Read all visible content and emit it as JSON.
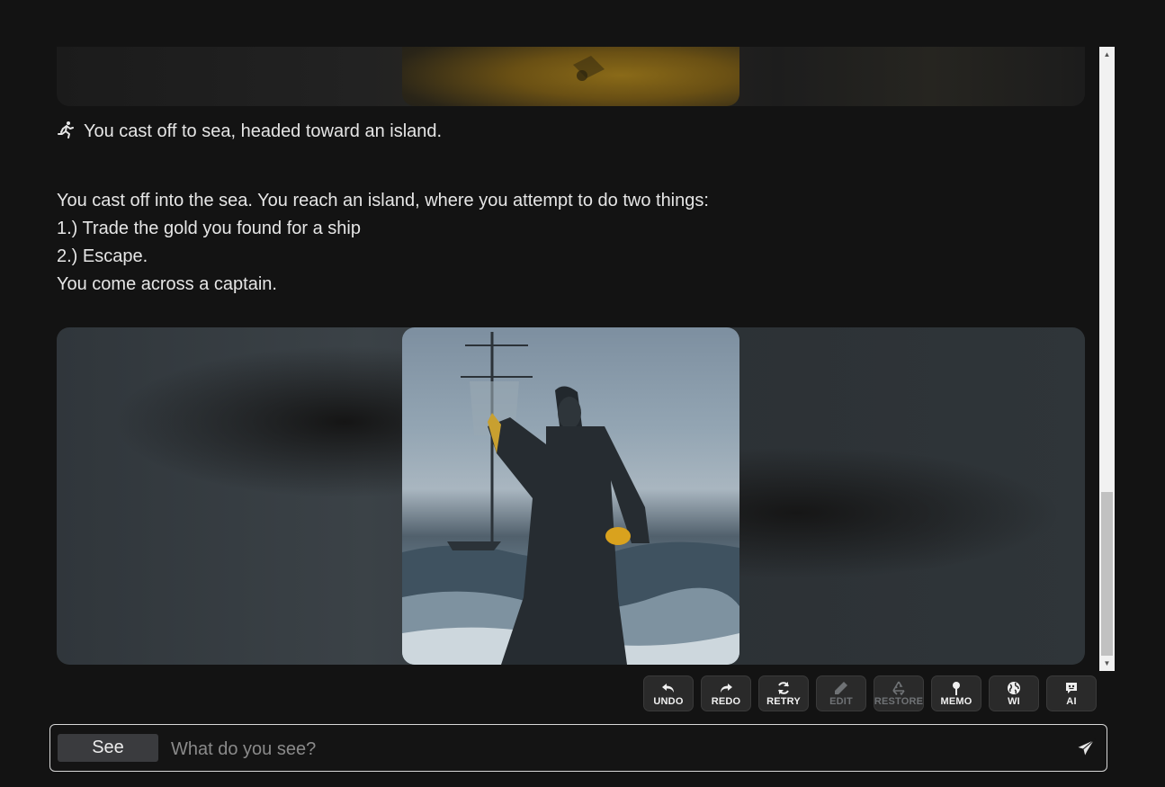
{
  "story": {
    "action_text": "You cast off to sea, headed toward an island.",
    "paragraph_lines": [
      "You cast off into the sea. You reach an island, where you attempt to do two things:",
      "1.) Trade the gold you found for a ship",
      "2.) Escape.",
      "You come across a captain."
    ],
    "action_icon": "running-person-icon"
  },
  "toolbar": {
    "buttons": [
      {
        "label": "UNDO",
        "icon": "undo-icon",
        "enabled": true
      },
      {
        "label": "REDO",
        "icon": "redo-icon",
        "enabled": true
      },
      {
        "label": "RETRY",
        "icon": "retry-icon",
        "enabled": true
      },
      {
        "label": "EDIT",
        "icon": "pencil-icon",
        "enabled": false
      },
      {
        "label": "RESTORE",
        "icon": "recycle-icon",
        "enabled": false
      },
      {
        "label": "MEMO",
        "icon": "pin-icon",
        "enabled": true
      },
      {
        "label": "WI",
        "icon": "globe-icon",
        "enabled": true
      },
      {
        "label": "AI",
        "icon": "robot-chat-icon",
        "enabled": true
      }
    ]
  },
  "input": {
    "mode_label": "See",
    "placeholder": "What do you see?",
    "value": ""
  },
  "colors": {
    "background": "#131313",
    "text": "#e6e6e6",
    "button_bg": "#2a2a2a",
    "disabled_text": "#6f7275"
  }
}
